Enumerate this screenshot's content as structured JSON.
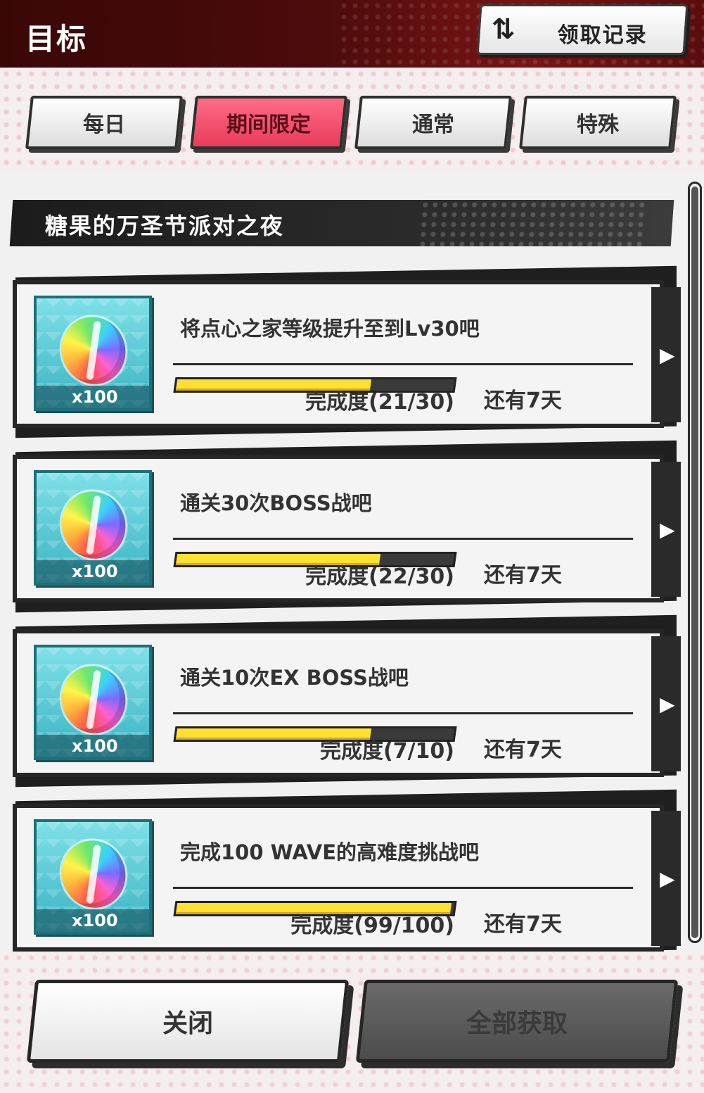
{
  "header": {
    "title": "目标",
    "history_icon": "⇅",
    "history_label": "领取记录"
  },
  "tabs": [
    {
      "label": "每日",
      "active": false
    },
    {
      "label": "期间限定",
      "active": true
    },
    {
      "label": "通常",
      "active": false
    },
    {
      "label": "特殊",
      "active": false
    }
  ],
  "section": {
    "title": "糖果的万圣节派对之夜"
  },
  "missions": [
    {
      "title": "将点心之家等级提升至到Lv30吧",
      "reward_qty": "x100",
      "completion": "完成度(21/30)",
      "progress": 0.7,
      "remaining": "还有7天"
    },
    {
      "title": "通关30次BOSS战吧",
      "reward_qty": "x100",
      "completion": "完成度(22/30)",
      "progress": 0.733,
      "remaining": "还有7天"
    },
    {
      "title": "通关10次EX BOSS战吧",
      "reward_qty": "x100",
      "completion": "完成度(7/10)",
      "progress": 0.7,
      "remaining": "还有7天"
    },
    {
      "title": "完成100 WAVE的高难度挑战吧",
      "reward_qty": "x100",
      "completion": "完成度(99/100)",
      "progress": 0.99,
      "remaining": "还有7天"
    }
  ],
  "footer": {
    "close_label": "关闭",
    "claim_all_label": "全部获取"
  },
  "colors": {
    "header_bg": "#4a0b0b",
    "active_tab": "#ff5b78",
    "progress_fill": "#ffe033",
    "reward_bg": "#3ab4c2"
  }
}
